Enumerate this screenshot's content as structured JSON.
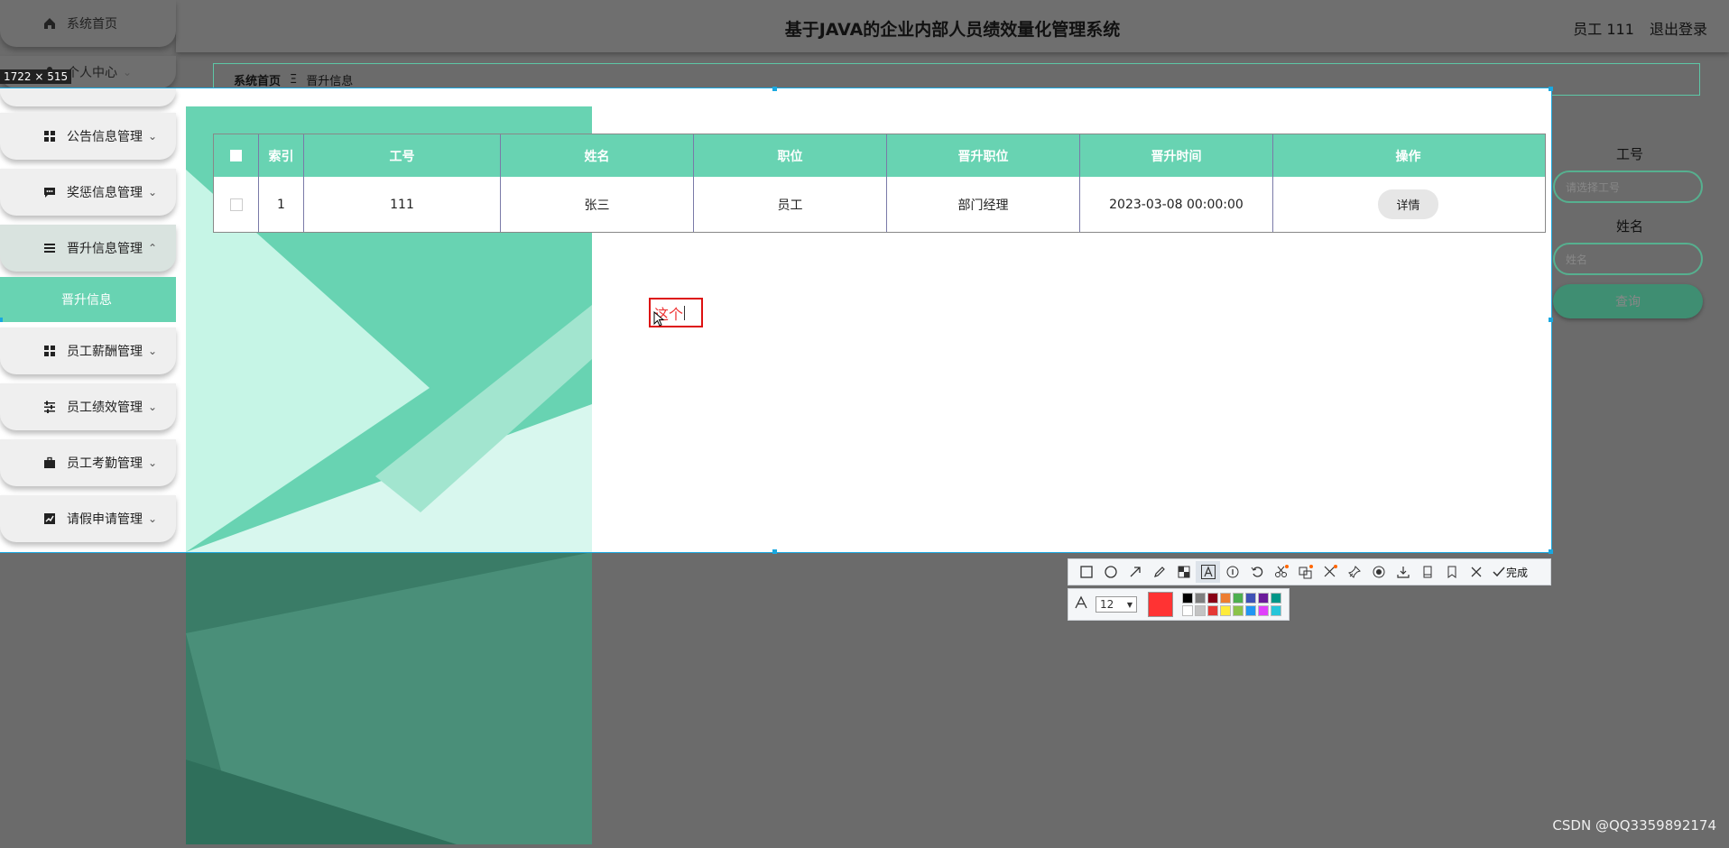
{
  "header": {
    "title": "基于JAVA的企业内部人员绩效量化管理系统",
    "user": "员工 111",
    "logout": "退出登录"
  },
  "size_tag": "1722 × 515",
  "sidebar": {
    "items": [
      {
        "label": "系统首页",
        "icon": "home-icon",
        "chevron": ""
      },
      {
        "label": "个人中心",
        "icon": "person-icon",
        "chevron": "⌄"
      },
      {
        "label": "公告信息管理",
        "icon": "grid-icon",
        "chevron": "⌄"
      },
      {
        "label": "奖惩信息管理",
        "icon": "message-icon",
        "chevron": "⌄"
      },
      {
        "label": "晋升信息管理",
        "icon": "menu-icon",
        "chevron": "⌃"
      },
      {
        "label": "员工薪酬管理",
        "icon": "grid-icon",
        "chevron": "⌄"
      },
      {
        "label": "员工绩效管理",
        "icon": "sliders-icon",
        "chevron": "⌄"
      },
      {
        "label": "员工考勤管理",
        "icon": "briefcase-icon",
        "chevron": "⌄"
      },
      {
        "label": "请假申请管理",
        "icon": "chart-icon",
        "chevron": "⌄"
      }
    ],
    "sub_item": "晋升信息"
  },
  "breadcrumb": {
    "home": "系统首页",
    "sep": "Ξ",
    "current": "晋升信息"
  },
  "table": {
    "headers": [
      "索引",
      "工号",
      "姓名",
      "职位",
      "晋升职位",
      "晋升时间",
      "操作"
    ],
    "rows": [
      {
        "index": "1",
        "emp_no": "111",
        "name": "张三",
        "position": "员工",
        "promoted_to": "部门经理",
        "time": "2023-03-08 00:00:00",
        "action": "详情"
      }
    ]
  },
  "annotation_text": "这个",
  "search_panel": {
    "emp_no_label": "工号",
    "emp_no_placeholder": "请选择工号",
    "name_label": "姓名",
    "name_placeholder": "姓名",
    "search_button": "查询"
  },
  "toolbar": {
    "tools": [
      "rectangle-icon",
      "ellipse-icon",
      "arrow-icon",
      "pen-icon",
      "mosaic-icon",
      "text-icon",
      "serial-number-icon",
      "undo-icon",
      "ocr-icon",
      "translate-icon",
      "pin-icon",
      "record-icon",
      "save-icon",
      "long-screenshot-icon",
      "bookmark-icon",
      "close-icon"
    ],
    "done_label": "完成",
    "font_size": "12",
    "current_color": "#ff3333",
    "palette": [
      "#000000",
      "#7f7f7f",
      "#880015",
      "#ed7d31",
      "#4caf50",
      "#3f51b5",
      "#6a1b9a",
      "#009688",
      "#ffffff",
      "#c3c3c3",
      "#e53935",
      "#ffeb3b",
      "#8bc34a",
      "#2196f3",
      "#e040fb",
      "#26c6da"
    ]
  },
  "watermark": "CSDN @QQ3359892174",
  "colors": {
    "accent": "#68d3b2",
    "selection": "#19a8e0",
    "annotation": "#dd1111"
  }
}
